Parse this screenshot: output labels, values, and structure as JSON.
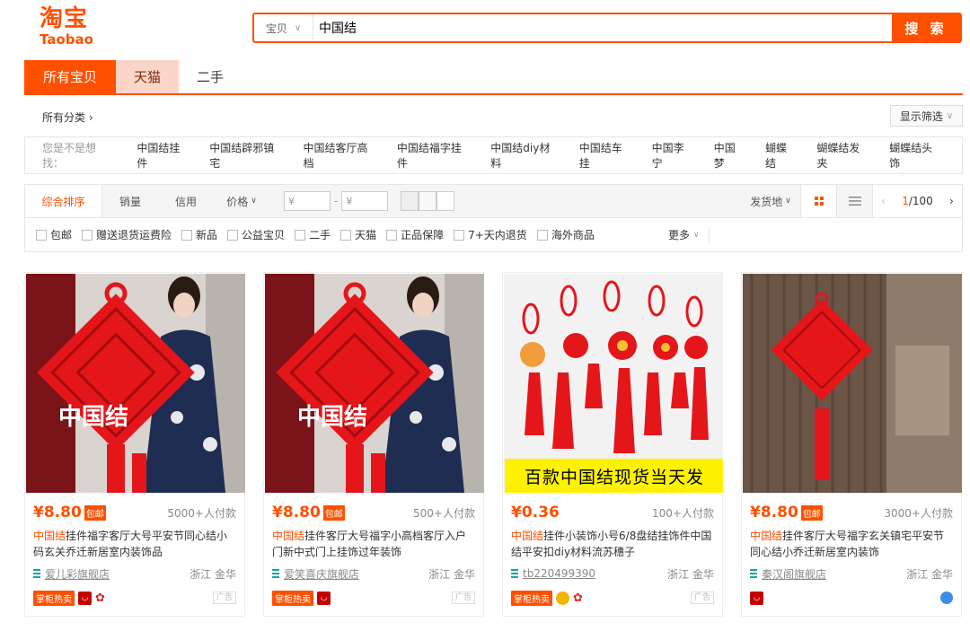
{
  "logo": {
    "cn": "淘宝",
    "en": "Taobao"
  },
  "search": {
    "scope": "宝贝",
    "query": "中国结",
    "button": "搜 索"
  },
  "tabs": [
    {
      "label": "所有宝贝"
    },
    {
      "label": "天猫"
    },
    {
      "label": "二手"
    }
  ],
  "category": {
    "label": "所有分类",
    "filter_button": "显示筛选"
  },
  "suggest": {
    "label": "您是不是想找：",
    "items": [
      "中国结挂件",
      "中国结辟邪镇宅",
      "中国结客厅高档",
      "中国结福字挂件",
      "中国结diy材料",
      "中国结车挂",
      "中国李宁",
      "中国梦",
      "蝴蝶结",
      "蝴蝶结发夹",
      "蝴蝶结头饰"
    ]
  },
  "sortbar": {
    "items": [
      "综合排序",
      "销量",
      "信用",
      "价格"
    ],
    "price_from": "¥",
    "price_to": "¥",
    "ship_from": "发货地",
    "page_current": "1",
    "page_total": "/100"
  },
  "checks": {
    "items": [
      "包邮",
      "赠送退货运费险",
      "新品",
      "公益宝贝",
      "二手",
      "天猫",
      "正品保障",
      "7+天内退货",
      "海外商品"
    ],
    "more": "更多"
  },
  "products": [
    {
      "price": "¥8.80",
      "post": "包邮",
      "sales": "5000+人付款",
      "title_hl": "中国结",
      "title_rest": "挂件福字客厅大号平安节同心结小码玄关乔迁新居室内装饰品",
      "shop": "爱儿彩旗舰店",
      "location": "浙江 金华",
      "hot": "掌柜热卖",
      "ad": "广告",
      "overlay": "中国结"
    },
    {
      "price": "¥8.80",
      "post": "包邮",
      "sales": "500+人付款",
      "title_hl": "中国结",
      "title_rest": "挂件客厅大号福字小高档客厅入户门新中式门上挂饰过年装饰",
      "shop": "爱笑喜庆旗舰店",
      "location": "浙江 金华",
      "hot": "掌柜热卖",
      "ad": "广告",
      "overlay": "中国结"
    },
    {
      "price": "¥0.36",
      "post": "",
      "sales": "100+人付款",
      "title_hl": "中国结",
      "title_rest": "挂件小装饰小号6/8盘结挂饰件中国结平安扣diy材料流苏穗子",
      "shop": "tb220499390",
      "location": "浙江 金华",
      "hot": "掌柜热卖",
      "ad": "广告",
      "banner": "百款中国结现货当天发"
    },
    {
      "price": "¥8.80",
      "post": "包邮",
      "sales": "3000+人付款",
      "title_hl": "中国结",
      "title_rest": "挂件客厅大号福字玄关镇宅平安节同心结小乔迁新居室内装饰",
      "shop": "秦汉阁旗舰店",
      "location": "浙江 金华",
      "hot": "",
      "ad": ""
    }
  ],
  "colors": {
    "accent": "#ff5000",
    "tmall_tab": "#fbd5c7",
    "banner_yellow": "#fff200"
  }
}
